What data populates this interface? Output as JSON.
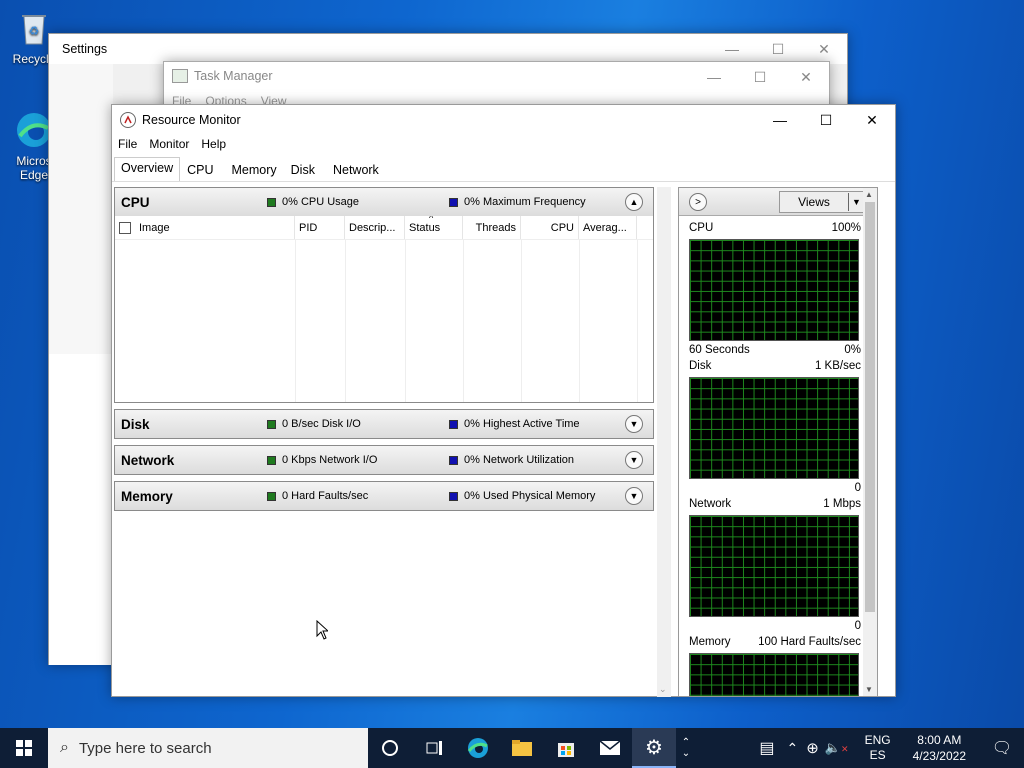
{
  "desktop": {
    "recycle_label": "Recycle",
    "edge_label_1": "Micros",
    "edge_label_2": "Edge"
  },
  "settings_window": {
    "title": "Settings"
  },
  "task_manager": {
    "title": "Task Manager",
    "menu": [
      "File",
      "Options",
      "View"
    ]
  },
  "resource_monitor": {
    "title": "Resource Monitor",
    "menu": [
      "File",
      "Monitor",
      "Help"
    ],
    "tabs": [
      "Overview",
      "CPU",
      "Memory",
      "Disk",
      "Network"
    ],
    "active_tab": "Overview",
    "cpu": {
      "name": "CPU",
      "metric1": "0% CPU Usage",
      "metric2": "0% Maximum Frequency",
      "columns": [
        "Image",
        "PID",
        "Descrip...",
        "Status",
        "Threads",
        "CPU",
        "Averag..."
      ]
    },
    "disk": {
      "name": "Disk",
      "metric1": "0 B/sec Disk I/O",
      "metric2": "0% Highest Active Time"
    },
    "network": {
      "name": "Network",
      "metric1": "0 Kbps Network I/O",
      "metric2": "0% Network Utilization"
    },
    "memory": {
      "name": "Memory",
      "metric1": "0 Hard Faults/sec",
      "metric2": "0% Used Physical Memory"
    },
    "views_label": "Views",
    "graphs": {
      "cpu": {
        "name": "CPU",
        "max": "100%",
        "footer_left": "60 Seconds",
        "footer_right": "0%"
      },
      "disk": {
        "name": "Disk",
        "max": "1 KB/sec",
        "footer_right": "0"
      },
      "network": {
        "name": "Network",
        "max": "1 Mbps",
        "footer_right": "0"
      },
      "memory": {
        "name": "Memory",
        "max": "100 Hard Faults/sec"
      }
    }
  },
  "taskbar": {
    "search_placeholder": "Type here to search",
    "lang_top": "ENG",
    "lang_bottom": "ES",
    "time": "8:00 AM",
    "date": "4/23/2022"
  }
}
